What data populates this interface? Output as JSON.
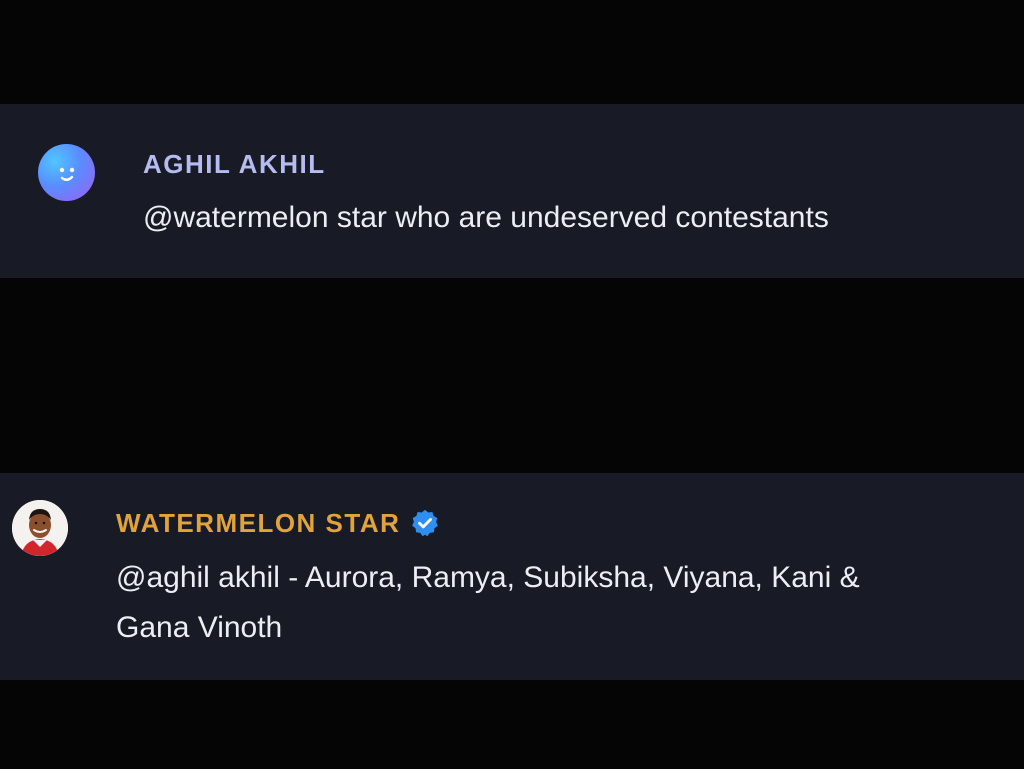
{
  "comments": [
    {
      "author": "AGHIL AKHIL",
      "mention": "@watermelon star",
      "text": " who are undeserved contestants",
      "author_color": "#b6bcf0"
    },
    {
      "author": "WATERMELON STAR",
      "verified": true,
      "mention": "@aghil akhil",
      "line1": "  - Aurora, Ramya, Subiksha, Viyana, Kani &",
      "line2": "Gana Vinoth",
      "author_color": "#e1a43a"
    }
  ],
  "icons": {
    "avatar_1": "smiley-face-avatar-icon",
    "avatar_2": "user-photo-avatar",
    "verified": "verified-check-badge-icon"
  }
}
